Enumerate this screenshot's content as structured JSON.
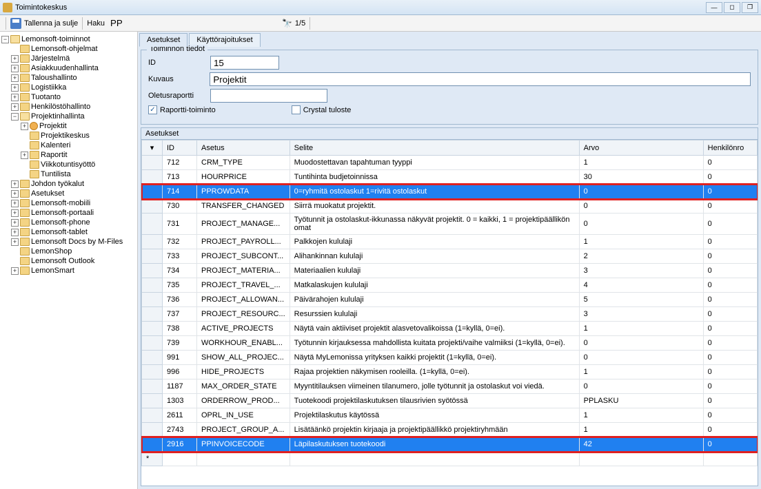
{
  "window": {
    "title": "Toimintokeskus"
  },
  "toolbar": {
    "save_label": "Tallenna ja sulje",
    "search_label": "Haku",
    "search_value": "PP",
    "page_indicator": "1/5"
  },
  "tree": {
    "root": "Lemonsoft-toiminnot",
    "items": [
      {
        "label": "Lemonsoft-ohjelmat",
        "lvl": 1,
        "leaf": true
      },
      {
        "label": "Järjestelmä",
        "lvl": 1,
        "exp": "+"
      },
      {
        "label": "Asiakkuudenhallinta",
        "lvl": 1,
        "exp": "+"
      },
      {
        "label": "Taloushallinto",
        "lvl": 1,
        "exp": "+"
      },
      {
        "label": "Logistiikka",
        "lvl": 1,
        "exp": "+"
      },
      {
        "label": "Tuotanto",
        "lvl": 1,
        "exp": "+"
      },
      {
        "label": "Henkilöstöhallinto",
        "lvl": 1,
        "exp": "+"
      },
      {
        "label": "Projektinhallinta",
        "lvl": 1,
        "exp": "-",
        "open": true
      },
      {
        "label": "Projektit",
        "lvl": 2,
        "exp": "+",
        "orange": true
      },
      {
        "label": "Projektikeskus",
        "lvl": 2,
        "leaf": true
      },
      {
        "label": "Kalenteri",
        "lvl": 2,
        "leaf": true
      },
      {
        "label": "Raportit",
        "lvl": 2,
        "exp": "+"
      },
      {
        "label": "Viikkotuntisyöttö",
        "lvl": 2,
        "leaf": true
      },
      {
        "label": "Tuntilista",
        "lvl": 2,
        "leaf": true
      },
      {
        "label": "Johdon työkalut",
        "lvl": 1,
        "exp": "+"
      },
      {
        "label": "Asetukset",
        "lvl": 1,
        "exp": "+"
      },
      {
        "label": "Lemonsoft-mobiili",
        "lvl": 1,
        "exp": "+"
      },
      {
        "label": "Lemonsoft-portaali",
        "lvl": 1,
        "exp": "+"
      },
      {
        "label": "Lemonsoft-phone",
        "lvl": 1,
        "exp": "+"
      },
      {
        "label": "Lemonsoft-tablet",
        "lvl": 1,
        "exp": "+"
      },
      {
        "label": "Lemonsoft Docs by M-Files",
        "lvl": 1,
        "exp": "+"
      },
      {
        "label": "LemonShop",
        "lvl": 1,
        "leaf": true
      },
      {
        "label": "Lemonsoft Outlook",
        "lvl": 1,
        "leaf": true
      },
      {
        "label": "LemonSmart",
        "lvl": 1,
        "exp": "+"
      }
    ]
  },
  "tabs": [
    {
      "label": "Asetukset",
      "active": true
    },
    {
      "label": "Käyttörajoitukset",
      "active": false
    }
  ],
  "form": {
    "group_title": "Toiminnon tiedot",
    "id_label": "ID",
    "id_value": "15",
    "kuvaus_label": "Kuvaus",
    "kuvaus_value": "Projektit",
    "oletus_label": "Oletusraportti",
    "oletus_value": "",
    "chk_raportti": "Raportti-toiminto",
    "chk_raportti_checked": true,
    "chk_crystal": "Crystal tuloste",
    "chk_crystal_checked": false
  },
  "grid": {
    "title": "Asetukset",
    "columns": [
      "ID",
      "Asetus",
      "Selite",
      "Arvo",
      "Henkilönro"
    ],
    "rows": [
      {
        "id": "712",
        "asetus": "CRM_TYPE",
        "selite": "Muodostettavan tapahtuman tyyppi",
        "arvo": "1",
        "h": "0"
      },
      {
        "id": "713",
        "asetus": "HOURPRICE",
        "selite": "Tuntihinta budjetoinnissa",
        "arvo": "30",
        "h": "0"
      },
      {
        "id": "714",
        "asetus": "PPROWDATA",
        "selite": "0=ryhmitä ostolaskut 1=rivitä ostolaskut",
        "arvo": "0",
        "h": "0",
        "sel": true,
        "hl": true
      },
      {
        "id": "730",
        "asetus": "TRANSFER_CHANGED",
        "selite": "Siirrä muokatut projektit.",
        "arvo": "0",
        "h": "0"
      },
      {
        "id": "731",
        "asetus": "PROJECT_MANAGE...",
        "selite": "Työtunnit ja ostolaskut-ikkunassa näkyvät projektit. 0 = kaikki, 1 = projektipäällikön omat",
        "arvo": "0",
        "h": "0"
      },
      {
        "id": "732",
        "asetus": "PROJECT_PAYROLL...",
        "selite": "Palkkojen kululaji",
        "arvo": "1",
        "h": "0"
      },
      {
        "id": "733",
        "asetus": "PROJECT_SUBCONT...",
        "selite": "Alihankinnan kululaji",
        "arvo": "2",
        "h": "0"
      },
      {
        "id": "734",
        "asetus": "PROJECT_MATERIA...",
        "selite": "Materiaalien kululaji",
        "arvo": "3",
        "h": "0"
      },
      {
        "id": "735",
        "asetus": "PROJECT_TRAVEL_...",
        "selite": "Matkalaskujen kululaji",
        "arvo": "4",
        "h": "0"
      },
      {
        "id": "736",
        "asetus": "PROJECT_ALLOWAN...",
        "selite": "Päivärahojen kululaji",
        "arvo": "5",
        "h": "0"
      },
      {
        "id": "737",
        "asetus": "PROJECT_RESOURC...",
        "selite": "Resurssien kululaji",
        "arvo": "3",
        "h": "0"
      },
      {
        "id": "738",
        "asetus": "ACTIVE_PROJECTS",
        "selite": "Näytä vain aktiiviset projektit alasvetovalikoissa (1=kyllä, 0=ei).",
        "arvo": "1",
        "h": "0"
      },
      {
        "id": "739",
        "asetus": "WORKHOUR_ENABL...",
        "selite": "Työtunnin kirjauksessa mahdollista kuitata projekti/vaihe valmiiksi (1=kyllä, 0=ei).",
        "arvo": "0",
        "h": "0"
      },
      {
        "id": "991",
        "asetus": "SHOW_ALL_PROJEC...",
        "selite": "Näytä MyLemonissa yrityksen kaikki projektit (1=kyllä, 0=ei).",
        "arvo": "0",
        "h": "0"
      },
      {
        "id": "996",
        "asetus": "HIDE_PROJECTS",
        "selite": "Rajaa projektien näkymisen rooleilla. (1=kyllä, 0=ei).",
        "arvo": "1",
        "h": "0"
      },
      {
        "id": "1187",
        "asetus": "MAX_ORDER_STATE",
        "selite": "Myyntitilauksen viimeinen tilanumero, jolle työtunnit ja ostolaskut voi viedä.",
        "arvo": "0",
        "h": "0"
      },
      {
        "id": "1303",
        "asetus": "ORDERROW_PROD...",
        "selite": "Tuotekoodi projektilaskutuksen tilausrivien syötössä",
        "arvo": "PPLASKU",
        "h": "0"
      },
      {
        "id": "2611",
        "asetus": "OPRL_IN_USE",
        "selite": "Projektilaskutus käytössä",
        "arvo": "1",
        "h": "0"
      },
      {
        "id": "2743",
        "asetus": "PROJECT_GROUP_A...",
        "selite": "Lisätäänkö projektin kirjaaja ja projektipäällikkö projektiryhmään",
        "arvo": "1",
        "h": "0"
      },
      {
        "id": "2916",
        "asetus": "PPINVOICECODE",
        "selite": "Läpilaskutuksen tuotekoodi",
        "arvo": "42",
        "h": "0",
        "sel": true,
        "hl": true
      },
      {
        "id": "",
        "asetus": "",
        "selite": "",
        "arvo": "",
        "h": "",
        "newrow": true
      }
    ]
  }
}
